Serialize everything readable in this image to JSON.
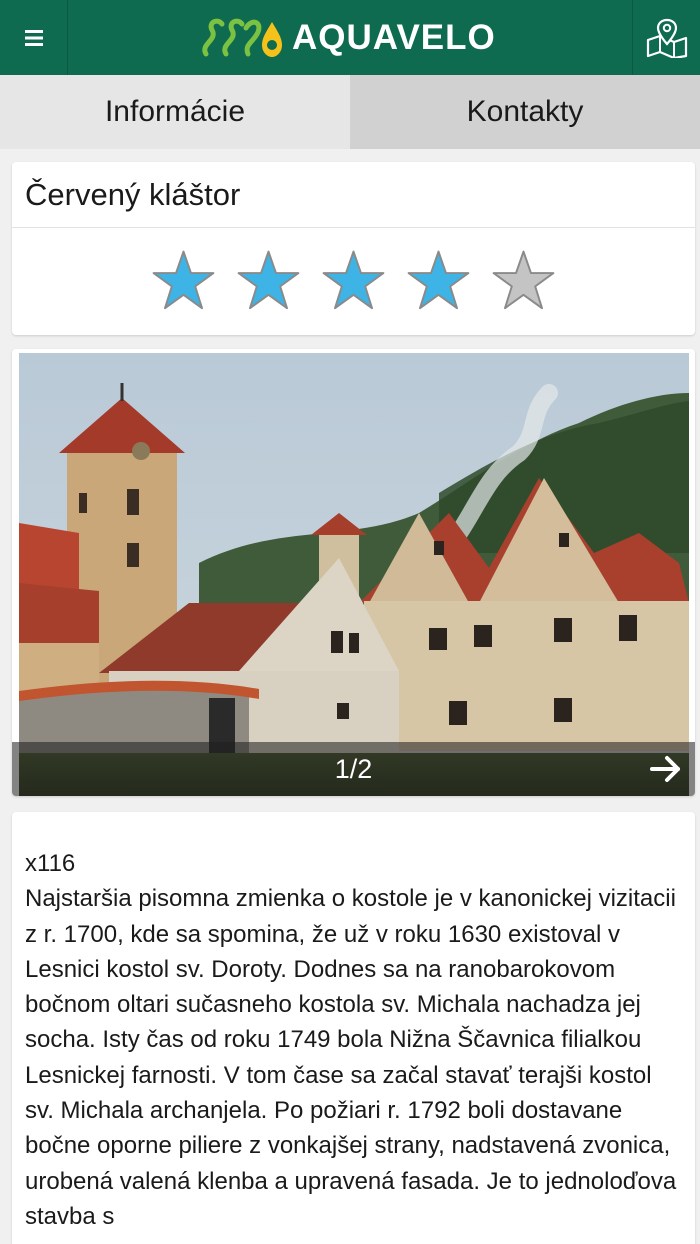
{
  "header": {
    "logo_text": "AQUAVELO",
    "menu_icon": "hamburger-menu-icon",
    "map_icon": "map-pin-icon",
    "brand_color": "#0e6b50"
  },
  "tabs": [
    {
      "label": "Informácie",
      "active": true
    },
    {
      "label": "Kontakty",
      "active": false
    }
  ],
  "place": {
    "title": "Červený kláštor",
    "rating": 4,
    "rating_max": 5,
    "star_color_filled": "#3db4e5",
    "star_color_empty": "#c4c4c4"
  },
  "gallery": {
    "counter": "1/2",
    "next_icon": "arrow-right-icon"
  },
  "description": {
    "code": "x116",
    "text": "Najstaršia pisomna zmienka o kostole je v kanonickej vizitacii z r. 1700, kde sa spomina, že už v roku 1630 existoval v Lesnici kostol sv. Doroty. Dodnes sa na ranobarokovom bočnom oltari sučasneho kostola sv. Michala nachadza jej socha. Isty čas od roku 1749 bola Nižna Ščavnica filialkou Lesnickej farnosti. V tom čase sa začal stavať terajši kostol sv. Michala archanjela. Po požiari r. 1792 boli dostavane bočne oporne piliere z vonkajšej strany, nadstavená zvonica, urobená valená klenba a upravená fasada. Je to jednoloďova stavba s"
  }
}
